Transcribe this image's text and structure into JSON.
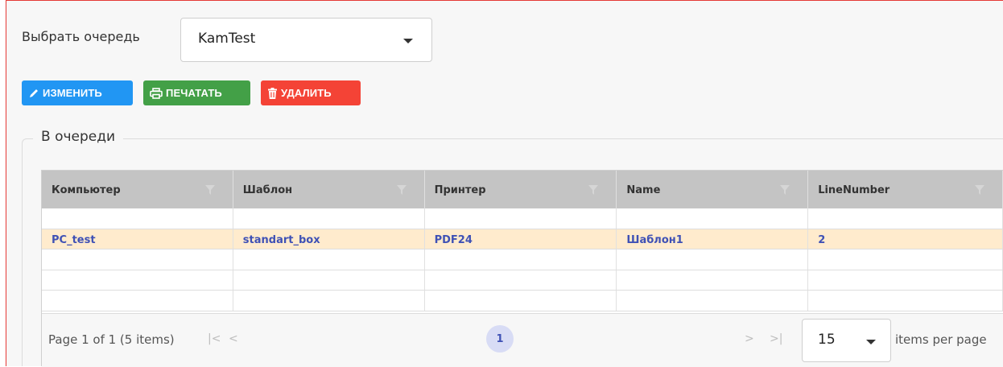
{
  "queue": {
    "label": "Выбрать очередь",
    "selected": "KamTest"
  },
  "toolbar": {
    "edit_label": "ИЗМЕНИТЬ",
    "print_label": "ПЕЧАТАТЬ",
    "delete_label": "УДАЛИТЬ"
  },
  "colors": {
    "edit": "#2196f3",
    "print": "#43a047",
    "delete": "#f44336",
    "selected_row": "#ffebcd",
    "cell_text": "#3f51b5"
  },
  "section": {
    "legend": "В очереди"
  },
  "grid": {
    "columns": [
      "Компьютер",
      "Шаблон",
      "Принтер",
      "Name",
      "LineNumber"
    ],
    "rows": [
      [
        "",
        "",
        "",
        "",
        ""
      ],
      [
        "PC_test",
        "standart_box",
        "PDF24",
        "Шаблон1",
        "2"
      ],
      [
        "",
        "",
        "",
        "",
        ""
      ],
      [
        "",
        "",
        "",
        "",
        ""
      ],
      [
        "",
        "",
        "",
        "",
        ""
      ]
    ],
    "selected_row": 1
  },
  "pager": {
    "info": "Page 1 of 1 (5 items)",
    "first": "|<",
    "prev": "<",
    "next": ">",
    "last": ">|",
    "current_page": "1",
    "page_size": "15",
    "per_page_label": "items per page"
  }
}
